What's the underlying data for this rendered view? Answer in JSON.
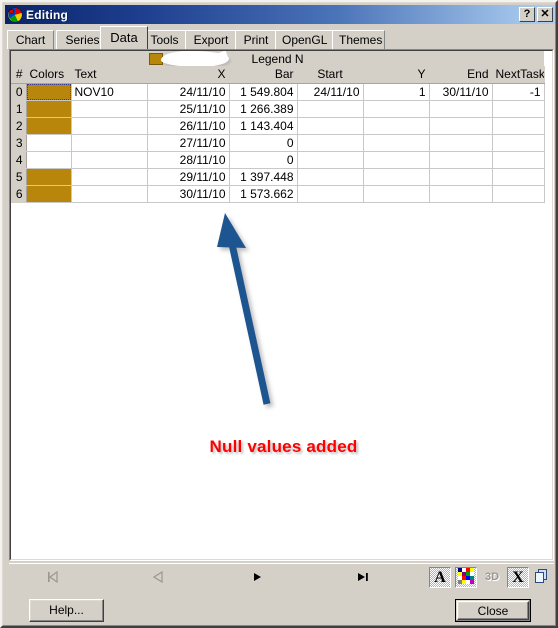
{
  "window": {
    "title": "Editing",
    "icon": "chart-pie-icon",
    "help_button": "?",
    "close_button": "✕"
  },
  "tabs": [
    {
      "label": "Chart",
      "selected": false
    },
    {
      "label": "Series",
      "selected": false
    },
    {
      "label": "Data",
      "selected": true
    },
    {
      "label": "Tools",
      "selected": false
    },
    {
      "label": "Export",
      "selected": false
    },
    {
      "label": "Print",
      "selected": false
    },
    {
      "label": "OpenGL",
      "selected": false
    },
    {
      "label": "Themes",
      "selected": false
    }
  ],
  "grid": {
    "legend_title": "Legend N",
    "legend_swatch_color": "#b8860b",
    "columns": [
      {
        "key": "idx",
        "label": "#",
        "align": "h-right"
      },
      {
        "key": "colors",
        "label": "Colors",
        "align": "h-left"
      },
      {
        "key": "text",
        "label": "Text",
        "align": "h-left"
      },
      {
        "key": "x",
        "label": "X",
        "align": "h-right"
      },
      {
        "key": "bar",
        "label": "Bar",
        "align": "h-right"
      },
      {
        "key": "start",
        "label": "Start",
        "align": "h-center"
      },
      {
        "key": "y",
        "label": "Y",
        "align": "h-right"
      },
      {
        "key": "end",
        "label": "End",
        "align": "h-right"
      },
      {
        "key": "nexttask",
        "label": "NextTask",
        "align": "h-right"
      }
    ],
    "rows": [
      {
        "idx": "0",
        "color": "#b8860b",
        "selected": true,
        "text": "NOV10",
        "x": "24/11/10",
        "bar": "1 549.804",
        "start": "24/11/10",
        "y": "1",
        "end": "30/11/10",
        "nexttask": "-1"
      },
      {
        "idx": "1",
        "color": "#b8860b",
        "selected": false,
        "text": "",
        "x": "25/11/10",
        "bar": "1 266.389",
        "start": "",
        "y": "",
        "end": "",
        "nexttask": ""
      },
      {
        "idx": "2",
        "color": "#b8860b",
        "selected": false,
        "text": "",
        "x": "26/11/10",
        "bar": "1 143.404",
        "start": "",
        "y": "",
        "end": "",
        "nexttask": ""
      },
      {
        "idx": "3",
        "color": "",
        "selected": false,
        "text": "",
        "x": "27/11/10",
        "bar": "0",
        "start": "",
        "y": "",
        "end": "",
        "nexttask": ""
      },
      {
        "idx": "4",
        "color": "",
        "selected": false,
        "text": "",
        "x": "28/11/10",
        "bar": "0",
        "start": "",
        "y": "",
        "end": "",
        "nexttask": ""
      },
      {
        "idx": "5",
        "color": "#b8860b",
        "selected": false,
        "text": "",
        "x": "29/11/10",
        "bar": "1 397.448",
        "start": "",
        "y": "",
        "end": "",
        "nexttask": ""
      },
      {
        "idx": "6",
        "color": "#b8860b",
        "selected": false,
        "text": "",
        "x": "30/11/10",
        "bar": "1 573.662",
        "start": "",
        "y": "",
        "end": "",
        "nexttask": ""
      }
    ]
  },
  "annotation": {
    "text": "Null values added",
    "text_color": "#ff0000",
    "arrow_color": "#1f5490"
  },
  "navigator": {
    "buttons": [
      {
        "name": "first-record-button",
        "glyph": "first",
        "enabled": false
      },
      {
        "name": "prev-record-button",
        "glyph": "prev",
        "enabled": false
      },
      {
        "name": "next-record-button",
        "glyph": "next",
        "enabled": true
      },
      {
        "name": "last-record-button",
        "glyph": "last",
        "enabled": true
      }
    ],
    "tools": [
      {
        "name": "font-button",
        "label": "A",
        "enabled": true
      },
      {
        "name": "color-button",
        "label": "",
        "enabled": true
      },
      {
        "name": "threed-button",
        "label": "3D",
        "enabled": false
      },
      {
        "name": "delete-button",
        "label": "X",
        "enabled": true
      },
      {
        "name": "copy-button",
        "label": "",
        "enabled": true
      }
    ]
  },
  "footer": {
    "help_label": "Help...",
    "close_label": "Close"
  }
}
